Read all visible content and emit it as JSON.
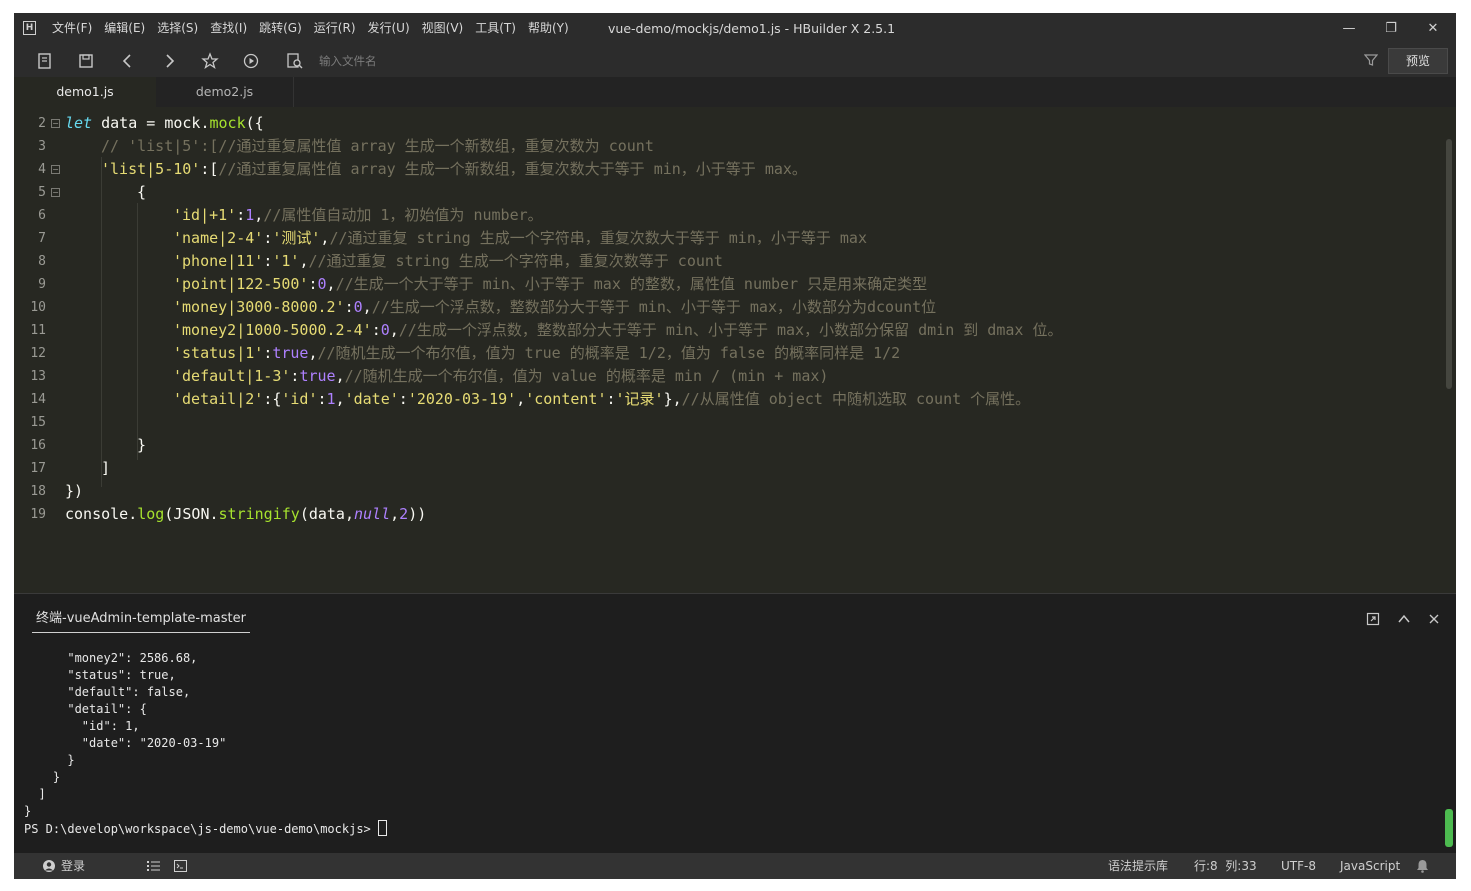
{
  "window": {
    "app_logo": "H",
    "title": "vue-demo/mockjs/demo1.js - HBuilder X 2.5.1",
    "menu": [
      "文件(F)",
      "编辑(E)",
      "选择(S)",
      "查找(I)",
      "跳转(G)",
      "运行(R)",
      "发行(U)",
      "视图(V)",
      "工具(T)",
      "帮助(Y)"
    ],
    "controls": {
      "minimize": "—",
      "restore": "❐",
      "close": "✕"
    }
  },
  "toolbar": {
    "icons": [
      "new-file-icon",
      "save-icon",
      "back-icon",
      "forward-icon",
      "star-icon",
      "run-icon",
      "file-search-icon"
    ],
    "file_input_placeholder": "输入文件名",
    "preview_label": "预览"
  },
  "tabs": [
    {
      "label": "demo1.js",
      "active": true
    },
    {
      "label": "demo2.js",
      "active": false
    }
  ],
  "editor": {
    "language": "JavaScript",
    "lines": [
      {
        "n": "2",
        "fold": true
      },
      {
        "n": "3",
        "fold": false
      },
      {
        "n": "4",
        "fold": true
      },
      {
        "n": "5",
        "fold": true
      },
      {
        "n": "6",
        "fold": false
      },
      {
        "n": "7",
        "fold": false
      },
      {
        "n": "8",
        "fold": false
      },
      {
        "n": "9",
        "fold": false
      },
      {
        "n": "10",
        "fold": false
      },
      {
        "n": "11",
        "fold": false
      },
      {
        "n": "12",
        "fold": false
      },
      {
        "n": "13",
        "fold": false
      },
      {
        "n": "14",
        "fold": false
      },
      {
        "n": "15",
        "fold": false
      },
      {
        "n": "16",
        "fold": false
      },
      {
        "n": "17",
        "fold": false
      },
      {
        "n": "18",
        "fold": false
      },
      {
        "n": "19",
        "fold": false
      }
    ],
    "code": {
      "l2": {
        "kw": "let",
        "a": " data = mock.",
        "fn": "mock",
        "b": "({"
      },
      "l3": {
        "cm": "// 'list|5':[//通过重复属性值 array 生成一个新数组，重复次数为 count"
      },
      "l4": {
        "str": "'list|5-10'",
        "a": ":[",
        "cm": "//通过重复属性值 array 生成一个新数组，重复次数大于等于 min，小于等于 max。"
      },
      "l5": {
        "a": "{"
      },
      "l6": {
        "str": "'id|+1'",
        "a": ":",
        "num": "1",
        "b": ",",
        "cm": "//属性值自动加 1，初始值为 number。"
      },
      "l7": {
        "str1": "'name|2-4'",
        "a": ":",
        "str2": "'测试'",
        "b": ",",
        "cm": "//通过重复 string 生成一个字符串，重复次数大于等于 min，小于等于 max"
      },
      "l8": {
        "str1": "'phone|11'",
        "a": ":",
        "str2": "'1'",
        "b": ",",
        "cm": "//通过重复 string 生成一个字符串，重复次数等于 count"
      },
      "l9": {
        "str": "'point|122-500'",
        "a": ":",
        "num": "0",
        "b": ",",
        "cm": "//生成一个大于等于 min、小于等于 max 的整数，属性值 number 只是用来确定类型"
      },
      "l10": {
        "str": "'money|3000-8000.2'",
        "a": ":",
        "num": "0",
        "b": ",",
        "cm": "//生成一个浮点数，整数部分大于等于 min、小于等于 max，小数部分为dcount位"
      },
      "l11": {
        "str": "'money2|1000-5000.2-4'",
        "a": ":",
        "num": "0",
        "b": ",",
        "cm": "//生成一个浮点数，整数部分大于等于 min、小于等于 max，小数部分保留 dmin 到 dmax 位。"
      },
      "l12": {
        "str": "'status|1'",
        "a": ":",
        "kw": "true",
        "b": ",",
        "cm": "//随机生成一个布尔值，值为 true 的概率是 1/2，值为 false 的概率同样是 1/2"
      },
      "l13": {
        "str": "'default|1-3'",
        "a": ":",
        "kw": "true",
        "b": ",",
        "cm": "//随机生成一个布尔值，值为 value 的概率是 min / (min + max)"
      },
      "l14": {
        "str1": "'detail|2'",
        "a": ":{",
        "str2": "'id'",
        "b": ":",
        "num": "1",
        "c": ",",
        "str3": "'date'",
        "d": ":",
        "str4": "'2020-03-19'",
        "e": ",",
        "str5": "'content'",
        "f": ":",
        "str6": "'记录'",
        "g": "},",
        "cm": "//从属性值 object 中随机选取 count 个属性。"
      },
      "l16": {
        "a": "}"
      },
      "l17": {
        "a": "]"
      },
      "l18": {
        "a": "})"
      },
      "l19": {
        "a": "console.",
        "fn1": "log",
        "b": "(JSON.",
        "fn2": "stringify",
        "c": "(data,",
        "nul": "null",
        "d": ",",
        "num": "2",
        "e": "))"
      }
    }
  },
  "terminal": {
    "tab_label": "终端-vueAdmin-template-master",
    "lines": [
      "      \"money2\": 2586.68,",
      "      \"status\": true,",
      "      \"default\": false,",
      "      \"detail\": {",
      "        \"id\": 1,",
      "        \"date\": \"2020-03-19\"",
      "      }",
      "    }",
      "  ]",
      "}"
    ],
    "prompt": "PS D:\\develop\\workspace\\js-demo\\vue-demo\\mockjs> "
  },
  "statusbar": {
    "login_label": "登录",
    "syntax_hint": "语法提示库",
    "position": "行:8  列:33",
    "encoding": "UTF-8",
    "language": "JavaScript"
  },
  "colors": {
    "editor_bg": "#272822",
    "keyword": "#66d9ef",
    "function": "#a6e22e",
    "string": "#e6db74",
    "number": "#ae81ff",
    "comment": "#75715e"
  }
}
